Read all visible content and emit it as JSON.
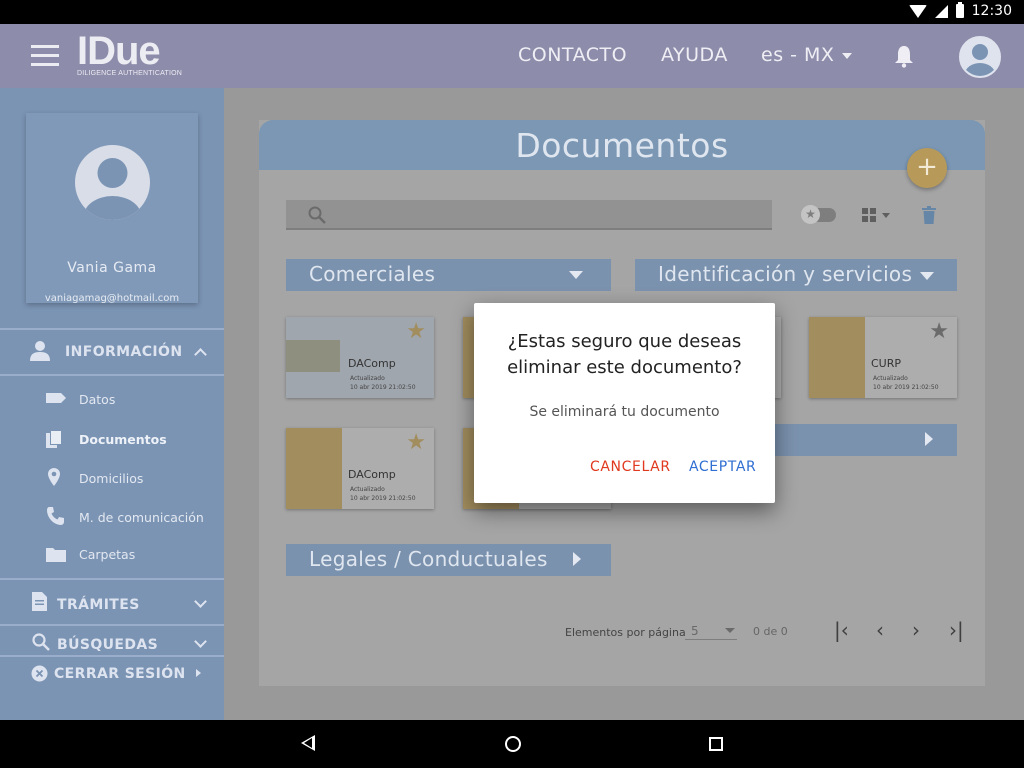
{
  "status_bar": {
    "time": "12:30"
  },
  "app_bar": {
    "logo_text": "IDue",
    "logo_subtitle": "DILIGENCE AUTHENTICATION",
    "nav_contact": "CONTACTO",
    "nav_help": "AYUDA",
    "language": "es - MX"
  },
  "profile": {
    "name": "Vania Gama",
    "email": "vaniagamag@hotmail.com"
  },
  "sidebar": {
    "info_header": "INFORMACIÓN",
    "items": [
      {
        "label": "Datos"
      },
      {
        "label": "Documentos"
      },
      {
        "label": "Domicilios"
      },
      {
        "label": "M. de comunicación"
      },
      {
        "label": "Carpetas"
      }
    ],
    "tramites": "TRÁMITES",
    "busquedas": "BÚSQUEDAS",
    "logout": "CERRAR SESIÓN"
  },
  "main": {
    "title": "Documentos",
    "fab_label": "+",
    "categories": {
      "comerciales": "Comerciales",
      "identificacion": "Identificación y servicios",
      "legales": "Legales / Conductuales"
    },
    "documents": [
      {
        "title": "DAComp",
        "updated_label": "Actualizado",
        "updated_date": "10 abr 2019 21:02:50"
      },
      {
        "title": "DAComp",
        "updated_label": "Actualizado",
        "updated_date": "10 abr 2019 21:02:50"
      },
      {
        "title": "CURP",
        "updated_label": "Actualizado",
        "updated_date": "10 abr 2019 21:02:50"
      }
    ],
    "pager": {
      "label": "Elementos por página",
      "per_page": "5",
      "range": "0 de 0"
    }
  },
  "dialog": {
    "title": "¿Estas seguro que deseas eliminar este documento?",
    "body": "Se eliminará tu documento",
    "cancel": "CANCELAR",
    "accept": "ACEPTAR"
  },
  "colors": {
    "app_bar": "#8d8caa",
    "sidebar": "#7b94b4",
    "cancel": "#e0391f",
    "accept": "#2f6ed2",
    "fab": "#b79a5a"
  }
}
